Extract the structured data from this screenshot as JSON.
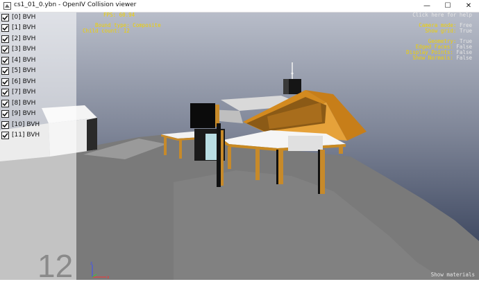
{
  "window": {
    "title": "cs1_01_0.ybn - OpenIV Collision viewer",
    "minimize": "—",
    "maximize": "☐",
    "close": "✕"
  },
  "bvh_list": [
    {
      "label": "[0] BVH",
      "checked": true
    },
    {
      "label": "[1] BVH",
      "checked": true
    },
    {
      "label": "[2] BVH",
      "checked": true
    },
    {
      "label": "[3] BVH",
      "checked": true
    },
    {
      "label": "[4] BVH",
      "checked": true
    },
    {
      "label": "[5] BVH",
      "checked": true
    },
    {
      "label": "[6] BVH",
      "checked": true
    },
    {
      "label": "[7] BVH",
      "checked": true
    },
    {
      "label": "[8] BVH",
      "checked": true
    },
    {
      "label": "[9] BVH",
      "checked": true
    },
    {
      "label": "[10] BVH",
      "checked": true
    },
    {
      "label": "[11] BVH",
      "checked": true
    }
  ],
  "child_count_big": "12",
  "overlay": {
    "fps": "FPS: 60.94",
    "bound_type": "Bound type: Composite",
    "child_count": "Child count: 12",
    "help": "Click here for help",
    "camera_mode_label": "Camera mode:",
    "camera_mode_value": "Free",
    "show_grid_label": "Show grid:",
    "show_grid_value": "True",
    "geometry_label": "Geometry:",
    "geometry_value": "True",
    "edged_faces_label": "Edged Faces:",
    "edged_faces_value": "False",
    "display_points_label": "Display Points:",
    "display_points_value": "False",
    "show_normals_label": "Show Normals:",
    "show_normals_value": "False",
    "show_materials": "Show materials"
  },
  "colors": {
    "sky_top": "#b9bdc8",
    "sky_bottom": "#2f3a52",
    "ground": "#7b7b7b",
    "roof": "#d38a1f",
    "wall": "#f2f2f2",
    "dark": "#0d0d0d",
    "label_yellow": "#f0d000"
  },
  "gizmo": {
    "z": "z",
    "x": "x"
  }
}
